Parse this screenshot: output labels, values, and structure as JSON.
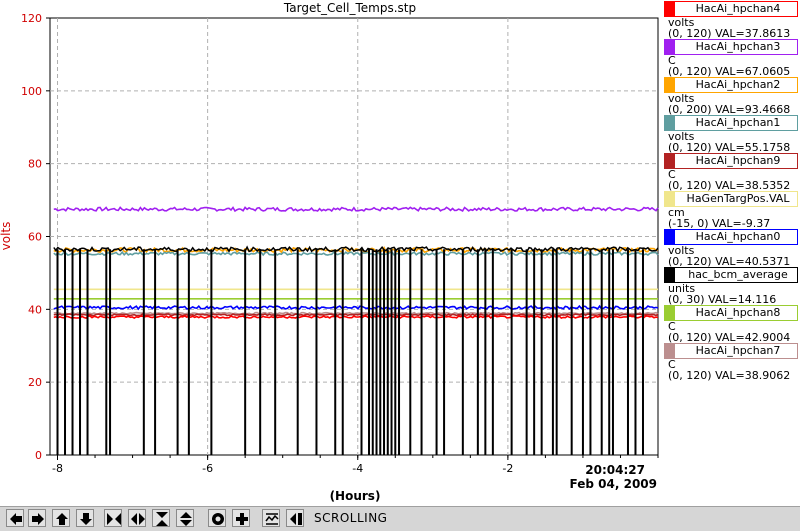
{
  "chart_data": {
    "type": "line",
    "title": "Target_Cell_Temps.stp",
    "ylabel": "volts",
    "xlabel": "(Hours)",
    "ylim": [
      0,
      120
    ],
    "xlim": [
      -8.1,
      0
    ],
    "y_ticks": [
      0,
      20,
      40,
      60,
      80,
      100,
      120
    ],
    "x_ticks": [
      -8,
      -6,
      -4,
      -2
    ],
    "x_tick_labels": [
      "-8",
      "-6",
      "-4",
      "-2"
    ],
    "end_time": "20:04:27",
    "end_date": "Feb 04, 2009",
    "grid": true,
    "legend_position": "right",
    "series": [
      {
        "name": "HacAi_hpchan3",
        "color": "#a020f0",
        "level": 67.5,
        "noise": 0.5
      },
      {
        "name": "HacAi_hpchan2",
        "color": "#ffa500",
        "level": 56.3,
        "noise": 0.6
      },
      {
        "name": "HacAi_hpchan1",
        "color": "#5f9ea0",
        "level": 55.3,
        "noise": 0.4
      },
      {
        "name": "HacGenTargPos.VAL",
        "color": "#f0e68c",
        "level": 45.5,
        "noise": 0.0
      },
      {
        "name": "HacAi_hpchan8",
        "color": "#9acd32",
        "level": 42.9,
        "noise": 0.0
      },
      {
        "name": "HacAi_hpchan0",
        "color": "#0000ff",
        "level": 40.5,
        "noise": 0.4
      },
      {
        "name": "HacAi_hpchan7",
        "color": "#bc8f8f",
        "level": 38.9,
        "noise": 0.2
      },
      {
        "name": "HacAi_hpchan9",
        "color": "#b22222",
        "level": 38.5,
        "noise": 0.2
      },
      {
        "name": "HacAi_hpchan4",
        "color": "#ff0000",
        "level": 37.9,
        "noise": 0.3
      },
      {
        "name": "hac_bcm_average",
        "color": "#000000",
        "level": 56.5,
        "noise": 0.6,
        "dropouts": true
      }
    ]
  },
  "legend": [
    {
      "name": "HacAi_hpchan4",
      "color": "#ff0000",
      "units": "volts",
      "range": "(0, 120) VAL=37.8613"
    },
    {
      "name": "HacAi_hpchan3",
      "color": "#a020f0",
      "units": "C",
      "range": "(0, 120) VAL=67.0605"
    },
    {
      "name": "HacAi_hpchan2",
      "color": "#ffa500",
      "units": "volts",
      "range": "(0, 200) VAL=93.4668"
    },
    {
      "name": "HacAi_hpchan1",
      "color": "#5f9ea0",
      "units": "volts",
      "range": "(0, 120) VAL=55.1758"
    },
    {
      "name": "HacAi_hpchan9",
      "color": "#b22222",
      "units": "C",
      "range": "(0, 120) VAL=38.5352"
    },
    {
      "name": "HaGenTargPos.VAL",
      "color": "#f0e68c",
      "units": "cm",
      "range": "(-15, 0) VAL=-9.37"
    },
    {
      "name": "HacAi_hpchan0",
      "color": "#0000ff",
      "units": "volts",
      "range": "(0, 120) VAL=40.5371"
    },
    {
      "name": "hac_bcm_average",
      "color": "#000000",
      "units": "units",
      "range": "(0, 30) VAL=14.116"
    },
    {
      "name": "HacAi_hpchan8",
      "color": "#9acd32",
      "units": "C",
      "range": "(0, 120) VAL=42.9004"
    },
    {
      "name": "HacAi_hpchan7",
      "color": "#bc8f8f",
      "units": "C",
      "range": "(0, 120) VAL=38.9062"
    }
  ],
  "toolbar": {
    "status": "SCROLLING",
    "buttons": [
      {
        "icon": "arrow-left-icon"
      },
      {
        "icon": "arrow-right-icon"
      },
      {
        "icon": "arrow-up-icon"
      },
      {
        "icon": "arrow-down-icon"
      },
      {
        "icon": "zoom-in-horizontal-icon"
      },
      {
        "icon": "zoom-out-horizontal-icon"
      },
      {
        "icon": "zoom-in-vertical-icon"
      },
      {
        "icon": "zoom-out-vertical-icon"
      },
      {
        "icon": "autoscale-icon"
      },
      {
        "icon": "add-icon"
      },
      {
        "icon": "scroll-mode-icon"
      },
      {
        "icon": "jump-to-end-icon"
      }
    ]
  }
}
